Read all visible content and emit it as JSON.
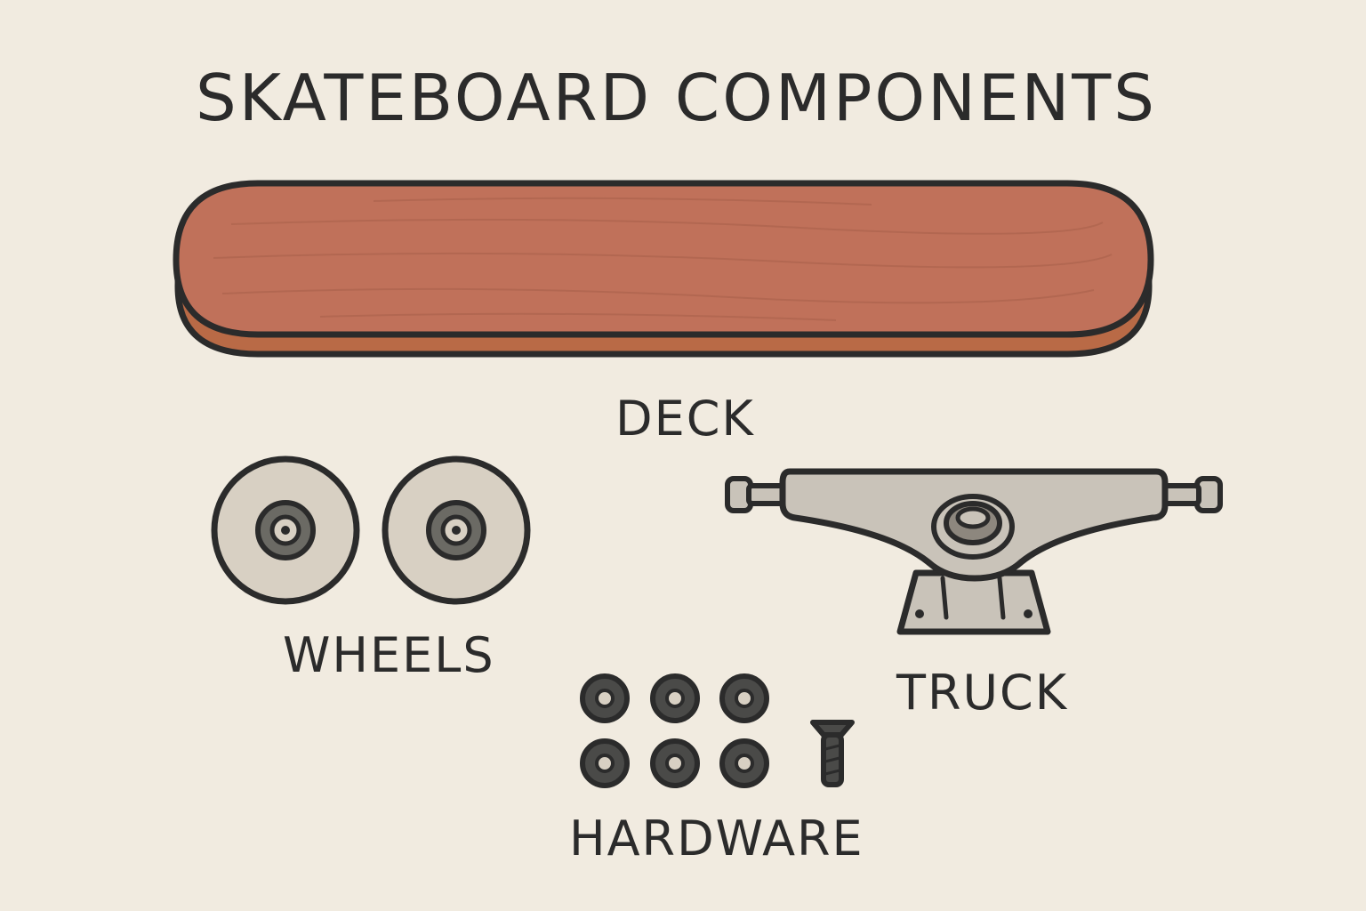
{
  "title": "SKATEBOARD COMPONENTS",
  "components": {
    "deck": {
      "label": "DECK",
      "icon": "deck-icon"
    },
    "wheels": {
      "label": "WHEELS",
      "icon": "wheel-icon",
      "count": 2
    },
    "truck": {
      "label": "TRUCK",
      "icon": "truck-icon"
    },
    "hardware": {
      "label": "HARDWARE",
      "icon": "bolt-icon",
      "nut_count": 6,
      "screw_count": 1
    }
  },
  "colors": {
    "background": "#f1ebe0",
    "outline": "#2b2b2b",
    "deck_top": "#c0715a",
    "deck_edge": "#b96a46",
    "wheel_fill": "#d8d0c3",
    "truck_fill": "#c9c3b9",
    "hardware_fill": "#4a4a48"
  }
}
